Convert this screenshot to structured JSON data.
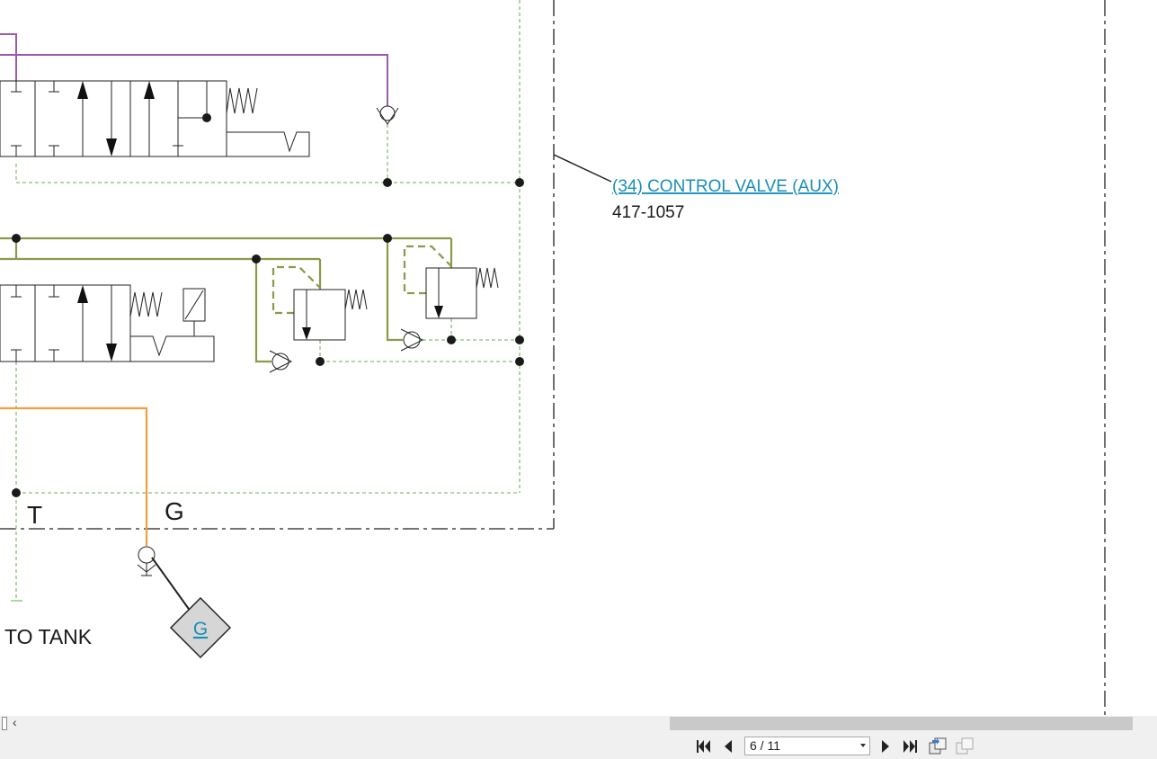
{
  "diagram": {
    "callout_label": "(34) CONTROL VALVE (AUX)",
    "callout_part_number": "417-1057",
    "port_t": "T",
    "port_g": "G",
    "to_tank": "TO TANK",
    "gauge_link": "G",
    "colors": {
      "purple_line": "#9b5bab",
      "green_line": "#8a9a4a",
      "pilot_dashed": "#9ccc8c",
      "orange_line": "#f0a040",
      "link": "#1a8fb5"
    }
  },
  "viewer": {
    "page_indicator": "6 / 11",
    "icons": [
      "first-page-icon",
      "previous-page-icon",
      "next-page-icon",
      "last-page-icon",
      "copy-page-icon",
      "multi-page-icon"
    ]
  }
}
